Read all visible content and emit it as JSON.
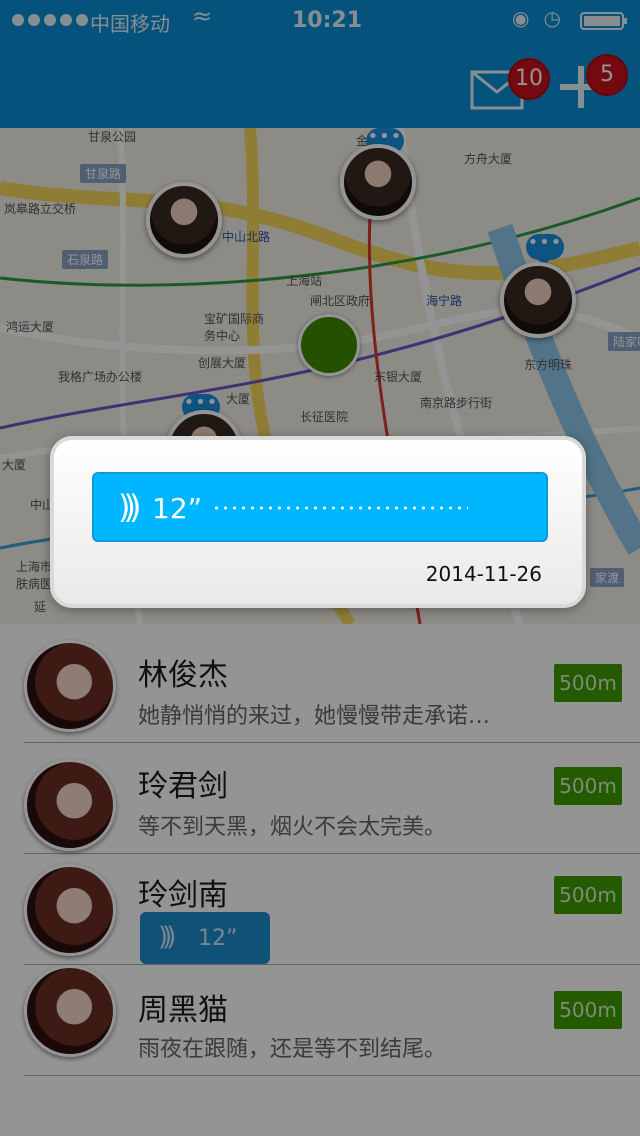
{
  "status_bar": {
    "carrier": "中国移动",
    "time": "10:21"
  },
  "nav": {
    "mail_badge": "10",
    "add_badge": "5",
    "icons": [
      "mail-icon",
      "plus-icon"
    ]
  },
  "map": {
    "labels": [
      "甘泉公园",
      "甘泉路",
      "岚皋路立交桥",
      "石泉路",
      "中山北路",
      "上海站",
      "闸北区政府",
      "金",
      "方舟大厦",
      "海宁路",
      "宝矿国际商务中心",
      "创展大厦",
      "东银大厦",
      "南京路步行街",
      "我格广场办公楼",
      "东方明珠",
      "陆家嘴",
      "鸿运大厦",
      "大厦",
      "长征医院",
      "中山",
      "上海市肤病医",
      "延",
      "大厦",
      "家渡"
    ]
  },
  "popup": {
    "duration": "12”",
    "date": "2014-11-26"
  },
  "contacts": [
    {
      "name": "林俊杰",
      "message": "她静悄悄的来过，她慢慢带走承诺…",
      "distance": "500m"
    },
    {
      "name": "玲君剑",
      "message": "等不到天黑，烟火不会太完美。",
      "distance": "500m"
    },
    {
      "name": "玲剑南",
      "voice_duration": "12”",
      "distance": "500m"
    },
    {
      "name": "周黑猫",
      "message": "雨夜在跟随，还是等不到结尾。",
      "distance": "500m"
    }
  ]
}
